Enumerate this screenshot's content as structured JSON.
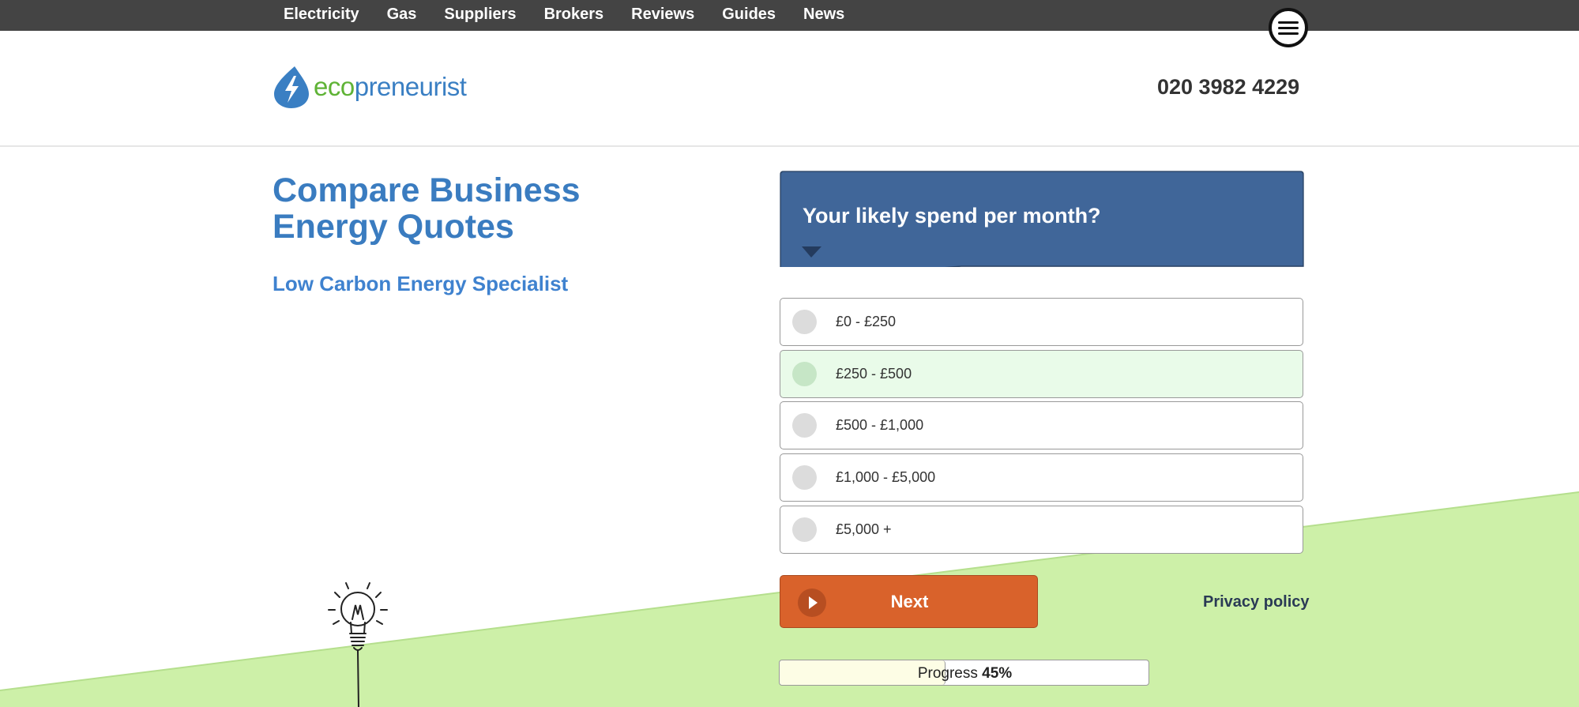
{
  "nav": {
    "items": [
      "Electricity",
      "Gas",
      "Suppliers",
      "Brokers",
      "Reviews",
      "Guides",
      "News"
    ],
    "menu_icon": "hamburger-menu-icon"
  },
  "header": {
    "logo_eco": "eco",
    "logo_rest": "preneurist",
    "phone": "020 3982 4229"
  },
  "main": {
    "title": "Compare Business Energy Quotes",
    "subtitle": "Low Carbon Energy Specialist"
  },
  "form": {
    "question": "Your likely spend per month?",
    "options": [
      {
        "label": "£0 - £250",
        "selected": false
      },
      {
        "label": "£250 - £500",
        "selected": true
      },
      {
        "label": "£500 - £1,000",
        "selected": false
      },
      {
        "label": "£1,000 - £5,000",
        "selected": false
      },
      {
        "label": "£5,000 +",
        "selected": false
      }
    ],
    "next_label": "Next",
    "privacy_label": "Privacy policy",
    "progress_label": "Progress",
    "progress_value": "45%",
    "progress_fraction": 0.45
  },
  "colors": {
    "nav_bg": "#444444",
    "accent_blue": "#3a7cc0",
    "banner_blue": "#3f6699",
    "next_orange": "#d9622b",
    "slope_green": "#cdf0a8",
    "selected_green": "#e9fbe9"
  }
}
